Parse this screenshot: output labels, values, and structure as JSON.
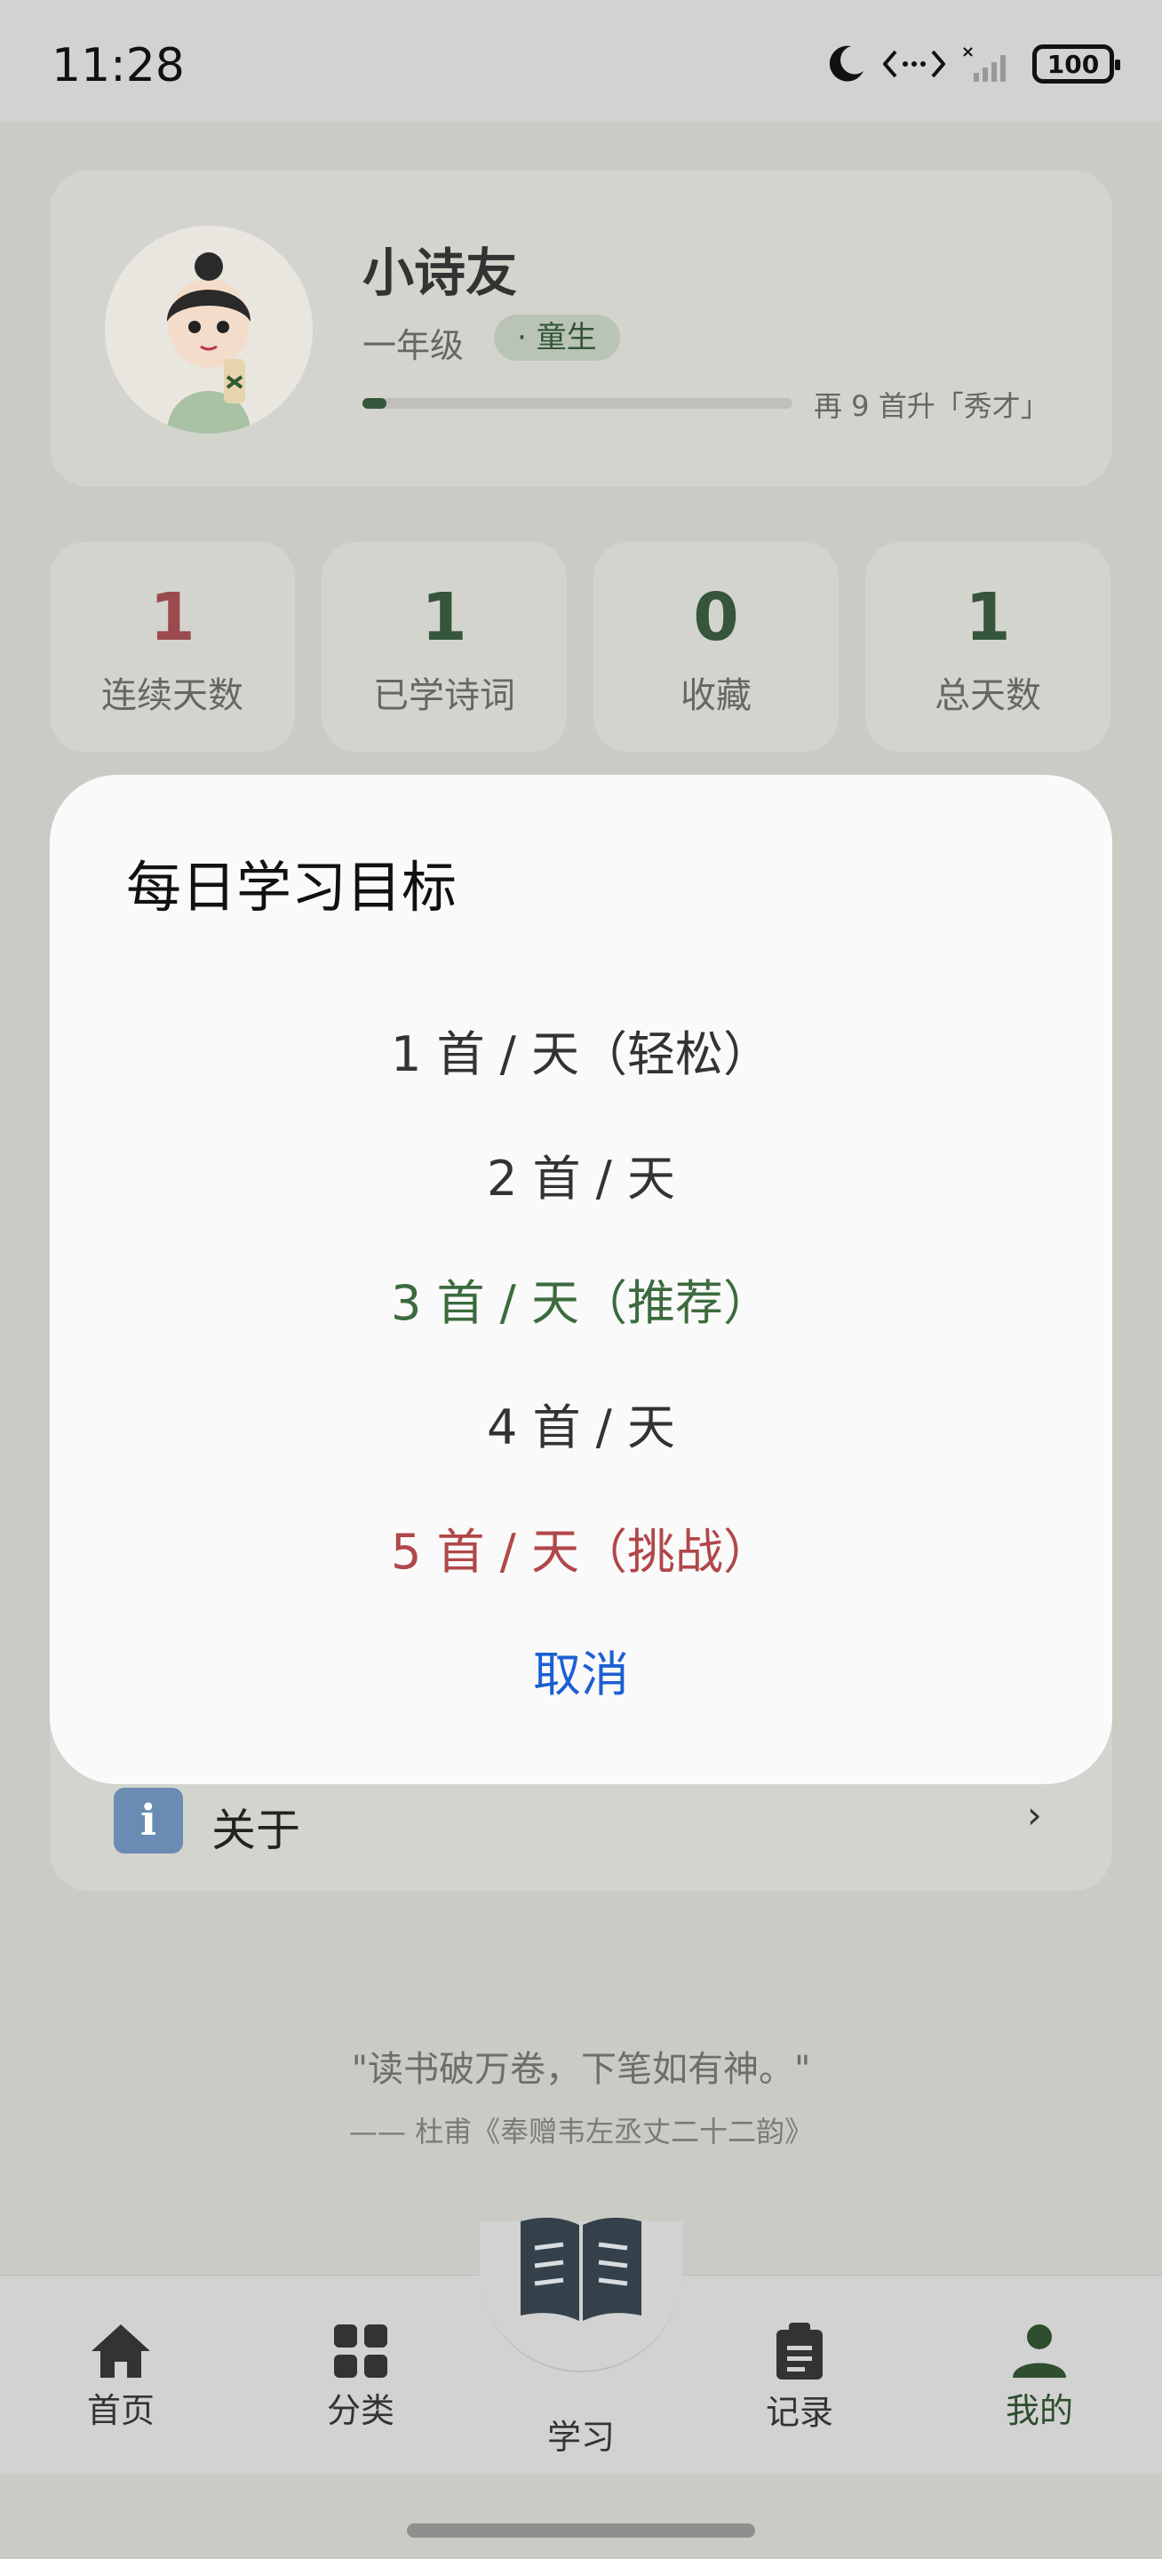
{
  "status_bar": {
    "time": "11:28",
    "battery": "100"
  },
  "profile": {
    "name": "小诗友",
    "grade": "一年级",
    "rank_badge": "· 童生",
    "progress_fraction": 0.055,
    "progress_text": "再 9 首升「秀才」"
  },
  "stats": [
    {
      "value": "1",
      "label": "连续天数"
    },
    {
      "value": "1",
      "label": "已学诗词"
    },
    {
      "value": "0",
      "label": "收藏"
    },
    {
      "value": "1",
      "label": "总天数"
    }
  ],
  "menu": {
    "about_label": "关于",
    "info_icon_glyph": "i",
    "chevron": "›"
  },
  "quote": {
    "text": "\"读书破万卷，下笔如有神。\"",
    "source": "—— 杜甫《奉赠韦左丞丈二十二韵》"
  },
  "dialog": {
    "title": "每日学习目标",
    "options": [
      "1 首 / 天（轻松）",
      "2 首 / 天",
      "3 首 / 天（推荐）",
      "4 首 / 天",
      "5 首 / 天（挑战）"
    ],
    "cancel_label": "取消"
  },
  "nav": {
    "items": [
      {
        "label": "首页",
        "icon": "home-icon"
      },
      {
        "label": "分类",
        "icon": "grid-icon"
      },
      {
        "label": "学习",
        "icon": "book-icon"
      },
      {
        "label": "记录",
        "icon": "clipboard-icon"
      },
      {
        "label": "我的",
        "icon": "person-icon"
      }
    ]
  },
  "colors": {
    "accent_green": "#35563a",
    "stat_red": "#9b4b4d",
    "option_green": "#3c6b3e",
    "option_red": "#b1474a",
    "cancel_blue": "#1c5fd3"
  }
}
